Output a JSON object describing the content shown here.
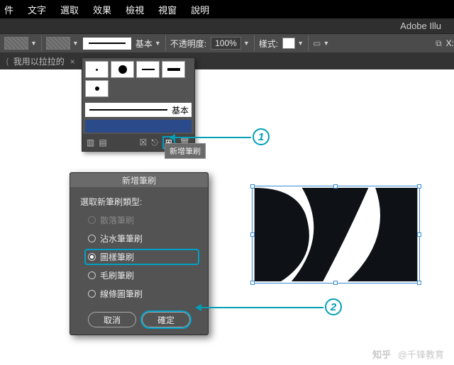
{
  "menubar": {
    "items": [
      "件",
      "文字",
      "選取",
      "效果",
      "檢視",
      "視窗",
      "說明"
    ]
  },
  "app": {
    "title": "Adobe Illu"
  },
  "optionsbar": {
    "brush_label_basic": "基本",
    "opacity_label": "不透明度:",
    "opacity_value": "100%",
    "style_label": "樣式:",
    "x_label": "X:"
  },
  "tab": {
    "title": "我用以拉拉的",
    "close": "×"
  },
  "brushes_panel": {
    "basic_label": "基本",
    "tooltip": "新增筆刷"
  },
  "dialog": {
    "title": "新增筆刷",
    "select_label": "選取新筆刷類型:",
    "options": [
      "散落筆刷",
      "沾水筆筆刷",
      "圖樣筆刷",
      "毛刷筆刷",
      "線條圖筆刷"
    ],
    "selected_index": 2,
    "cancel": "取消",
    "ok": "確定"
  },
  "annotations": {
    "step1": "1",
    "step2": "2"
  },
  "watermark": {
    "brand": "知乎",
    "author": "@千锋教育"
  }
}
